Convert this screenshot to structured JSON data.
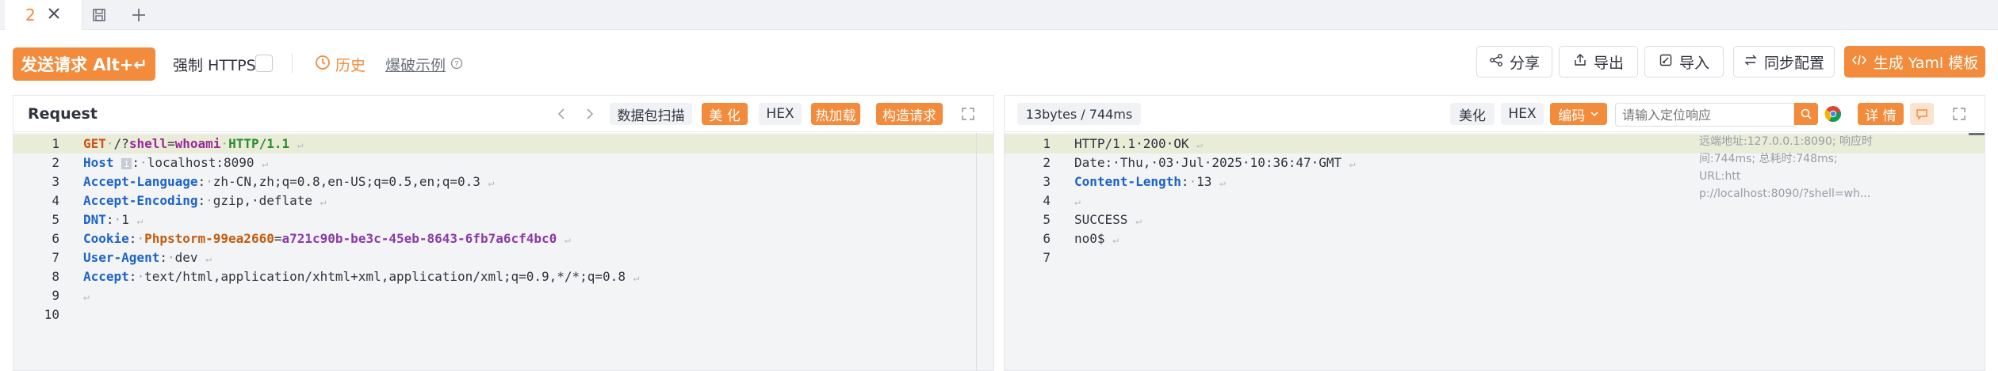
{
  "tabs": {
    "active_label": "2"
  },
  "toolbar": {
    "send_label": "发送请求 Alt+↵",
    "force_https_label": "强制 HTTPS",
    "history_label": "历史",
    "example_label": "爆破示例",
    "share_label": "分享",
    "export_label": "导出",
    "import_label": "导入",
    "sync_label": "同步配置",
    "yaml_label": "生成 Yaml 模板"
  },
  "request": {
    "title": "Request",
    "scan_label": "数据包扫描",
    "beautify_label": "美 化",
    "hex_label": "HEX",
    "hot_label": "热加载",
    "build_label": "构造请求",
    "line_numbers": [
      "1",
      "2",
      "3",
      "4",
      "5",
      "6",
      "7",
      "8",
      "9",
      "10"
    ],
    "lines": {
      "l1": {
        "method": "GET",
        "path1": "/?",
        "param": "shell",
        "eq": "=",
        "value": "whoami",
        "proto": "HTTP/1.1"
      },
      "l2": {
        "key": "Host",
        "value": "localhost:8090"
      },
      "l3": {
        "key": "Accept-Language",
        "value": "zh-CN,zh;q=0.8,en-US;q=0.5,en;q=0.3"
      },
      "l4": {
        "key": "Accept-Encoding",
        "value": "gzip, deflate"
      },
      "l5": {
        "key": "DNT",
        "value": "1"
      },
      "l6": {
        "key": "Cookie",
        "cname": "Phpstorm-99ea2660",
        "cval": "a721c90b-be3c-45eb-8643-6fb7a6cf4bc0"
      },
      "l7": {
        "key": "User-Agent",
        "value": "dev"
      },
      "l8": {
        "key": "Accept",
        "value": "text/html,application/xhtml+xml,application/xml;q=0.9,*/*;q=0.8"
      }
    }
  },
  "response": {
    "size_label": "13bytes / 744ms",
    "beautify_label": "美化",
    "hex_label": "HEX",
    "encode_label": "编码",
    "search_placeholder": "请输入定位响应",
    "detail_label": "详 情",
    "line_numbers": [
      "1",
      "2",
      "3",
      "4",
      "5",
      "6",
      "7"
    ],
    "lines": {
      "l1": "HTTP/1.1 200 OK",
      "l2": "Date: Thu, 03 Jul 2025 10:36:47 GMT",
      "l3_key": "Content-Length",
      "l3_val": "13",
      "l5": "SUCCESS",
      "l6": "no0$"
    },
    "info_lines": [
      "远端地址:127.0.0.1:8090; 响应时",
      "间:744ms; 总耗时:748ms; URL:htt",
      "p://localhost:8090/?shell=wh..."
    ]
  },
  "colors": {
    "accent": "#f28b3b",
    "highlight": "#e9edd8",
    "editor_bg": "#f3f4f6"
  }
}
